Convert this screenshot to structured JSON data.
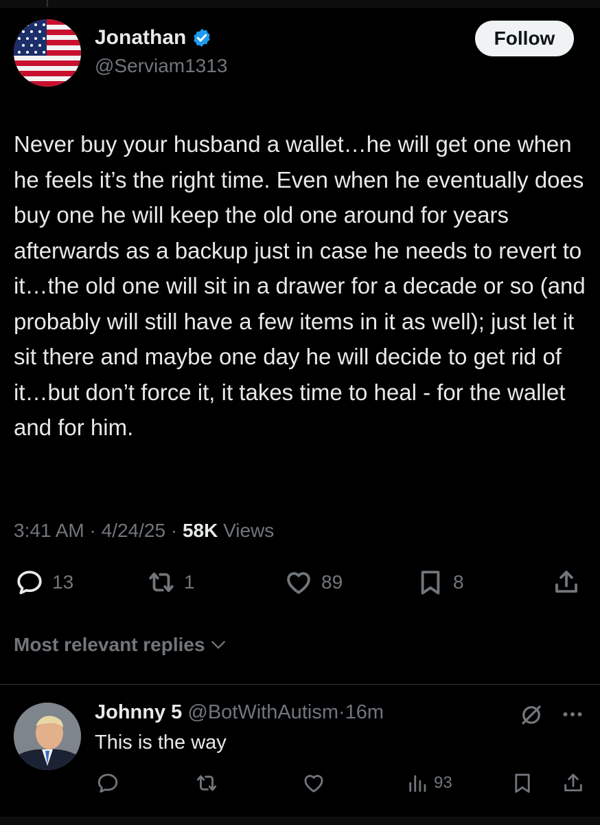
{
  "tweet": {
    "author_name": "Jonathan",
    "author_handle": "@Serviam1313",
    "follow_label": "Follow",
    "text": "Never buy your husband a wallet…he will get one when he feels it’s the right time. Even when he eventually does buy one he will keep the old one around for years afterwards as a backup just in case he needs to revert to it…the old one will sit in a drawer for a decade or so (and probably will still have a few items in it as well); just let it sit there and maybe one day he will decide to get rid of it…but don’t force it, it takes time to heal - for the wallet and for him.",
    "time": "3:41 AM",
    "date": "4/24/25",
    "views_count": "58K",
    "views_label": "Views",
    "separator": "·",
    "replies": "13",
    "reposts": "1",
    "likes": "89",
    "bookmarks": "8"
  },
  "replies_section": {
    "label": "Most relevant replies"
  },
  "reply": {
    "author_name": "Johnny 5",
    "author_handle": "@BotWithAutism",
    "separator": "·",
    "age": "16m",
    "text": "This is the way",
    "views": "93"
  },
  "colors": {
    "background": "#000000",
    "text_primary": "#e7e9ea",
    "text_secondary": "#71767b",
    "verified_blue": "#1d9bf0",
    "follow_bg": "#eff3f4"
  },
  "icons": [
    "verified-badge-icon",
    "reply-icon",
    "repost-icon",
    "like-icon",
    "bookmark-icon",
    "share-icon",
    "chevron-down-icon",
    "mute-icon",
    "more-icon",
    "views-icon"
  ]
}
